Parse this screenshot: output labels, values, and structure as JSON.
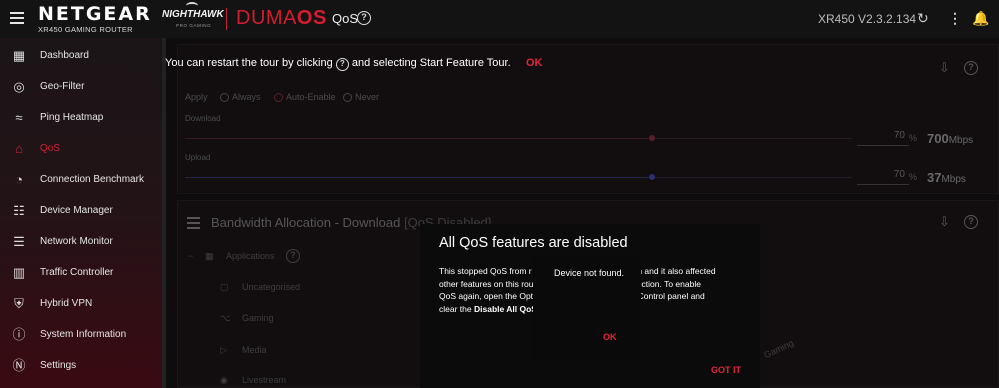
{
  "header": {
    "brand": "NETGEAR",
    "brand_sub": "XR450 GAMING ROUTER",
    "nighthawk": "NIGHTHAWK",
    "nighthawk_sub": "PRO GAMING",
    "os_name_1": "DUMA",
    "os_name_2": "OS",
    "page": "QoS",
    "version": "XR450 V2.3.2.134"
  },
  "sidebar": {
    "items": [
      {
        "label": "Dashboard",
        "icon": "dashboard-icon"
      },
      {
        "label": "Geo-Filter",
        "icon": "geo-filter-icon"
      },
      {
        "label": "Ping Heatmap",
        "icon": "ping-heatmap-icon"
      },
      {
        "label": "QoS",
        "icon": "qos-icon"
      },
      {
        "label": "Connection Benchmark",
        "icon": "speedometer-icon"
      },
      {
        "label": "Device Manager",
        "icon": "device-manager-icon"
      },
      {
        "label": "Network Monitor",
        "icon": "network-monitor-icon"
      },
      {
        "label": "Traffic Controller",
        "icon": "traffic-controller-icon"
      },
      {
        "label": "Hybrid VPN",
        "icon": "shield-icon"
      },
      {
        "label": "System Information",
        "icon": "info-icon"
      },
      {
        "label": "Settings",
        "icon": "settings-icon"
      }
    ],
    "active": "QoS"
  },
  "tour": {
    "text_before": "You can restart the tour by clicking",
    "text_after": "and selecting Start Feature Tour.",
    "ok": "OK"
  },
  "qos_panel": {
    "apply_label": "Apply",
    "options": [
      "Always",
      "Auto-Enable",
      "Never"
    ],
    "selected": "Auto-Enable",
    "download_label": "Download",
    "download_percent": "70",
    "download_rate": "700",
    "upload_label": "Upload",
    "upload_percent": "70",
    "upload_rate": "37",
    "percent_sign": "%",
    "unit": "Mbps"
  },
  "bw_panel": {
    "title": "Bandwidth Allocation - Download",
    "status": "[QoS Disabled]",
    "tree": [
      "Applications",
      "Uncategorised",
      "Gaming",
      "Media",
      "Livestream"
    ],
    "side_label": "Gaming"
  },
  "modal": {
    "title": "All QoS features are disabled",
    "body_1": "This stopped QoS from r",
    "body_1b": "on and it also affected",
    "body_2": "other features on this rou",
    "body_2b": "t inspection. To enable",
    "body_3": "QoS again, open the Opti",
    "body_3b": "ion Control panel and",
    "body_4": "clear the",
    "body_4_bold": "Disable All QoS",
    "got_it": "GOT IT"
  },
  "toast": {
    "message": "Device not found.",
    "ok": "OK"
  },
  "colors": {
    "accent": "#d31c2f",
    "background": "#0e0c0d"
  }
}
